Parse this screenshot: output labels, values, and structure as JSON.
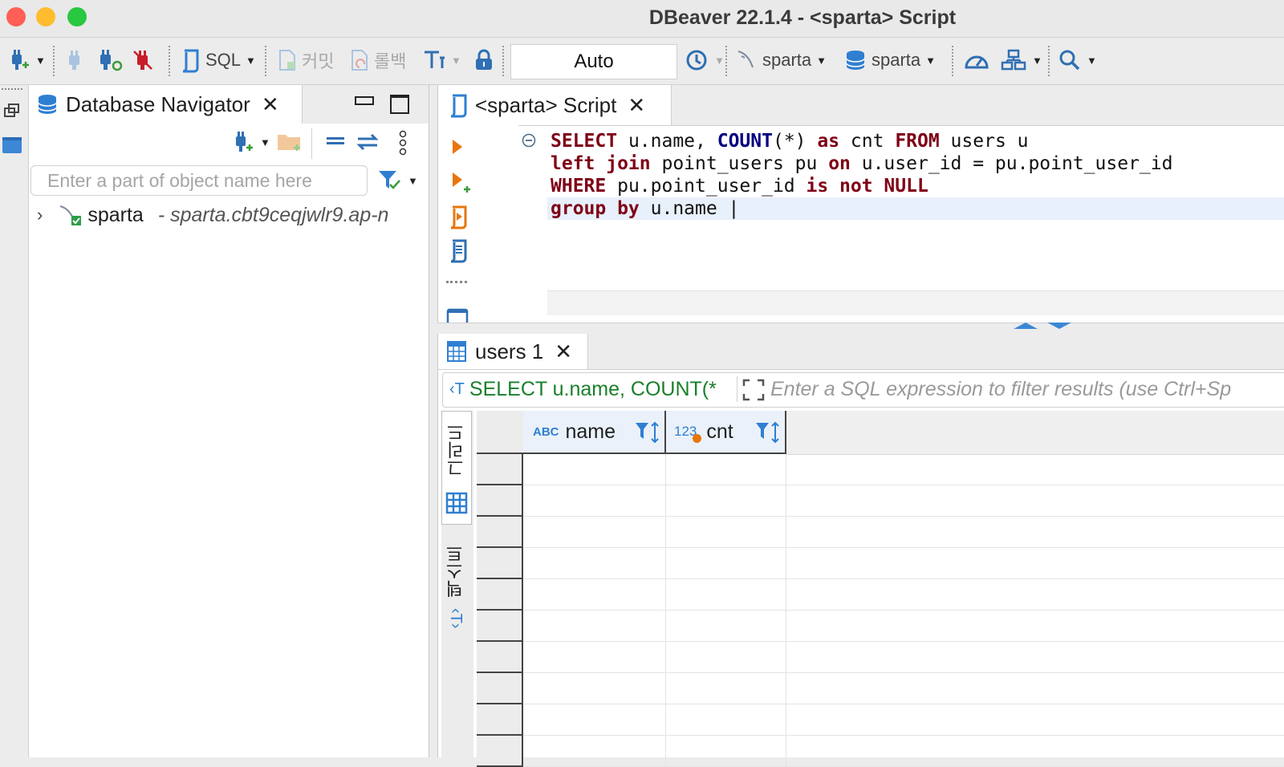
{
  "window": {
    "title": "DBeaver 22.1.4 - <sparta> Script",
    "traffic_lights": [
      "#ff5f57",
      "#febc2e",
      "#28c840"
    ]
  },
  "toolbar": {
    "sql_label": "SQL",
    "commit_label": "커밋",
    "rollback_label": "롤백",
    "transaction_mode": "Auto",
    "datasource_label": "sparta",
    "schema_label": "sparta"
  },
  "navigator": {
    "tab_label": "Database Navigator",
    "search_placeholder": "Enter a part of object name here",
    "tree": [
      {
        "name": "sparta",
        "detail": "- sparta.cbt9ceqjwlr9.ap-n"
      }
    ]
  },
  "editor": {
    "tab_label": "<sparta> Script",
    "lines": [
      [
        [
          "kw",
          "SELECT"
        ],
        [
          "id",
          " u.name, "
        ],
        [
          "fn",
          "COUNT"
        ],
        [
          "id",
          "(*) "
        ],
        [
          "kw",
          "as"
        ],
        [
          "id",
          " cnt "
        ],
        [
          "kw",
          "FROM"
        ],
        [
          "id",
          " users u"
        ]
      ],
      [
        [
          "kw",
          "left join"
        ],
        [
          "id",
          " point_users pu "
        ],
        [
          "kw",
          "on"
        ],
        [
          "id",
          " u.user_id = pu.point_user_id"
        ]
      ],
      [
        [
          "kw",
          "WHERE"
        ],
        [
          "id",
          " pu.point_user_id "
        ],
        [
          "kw",
          "is not NULL"
        ]
      ],
      [
        [
          "kw",
          "group by"
        ],
        [
          "id",
          " u.name |"
        ]
      ]
    ]
  },
  "results": {
    "tab_label": "users 1",
    "filter_sql": "SELECT u.name, COUNT(*",
    "filter_placeholder": "Enter a SQL expression to filter results (use Ctrl+Sp",
    "side_tabs": [
      "그리드",
      "텍스트"
    ],
    "columns": [
      {
        "type_badge": "ABC",
        "name": "name"
      },
      {
        "type_badge": "123",
        "name": "cnt"
      }
    ],
    "row_count": 0
  },
  "colors": {
    "accent": "#2f7fd1",
    "keyword": "#7f0016",
    "function": "#000080",
    "filter_sql": "#19802b"
  }
}
